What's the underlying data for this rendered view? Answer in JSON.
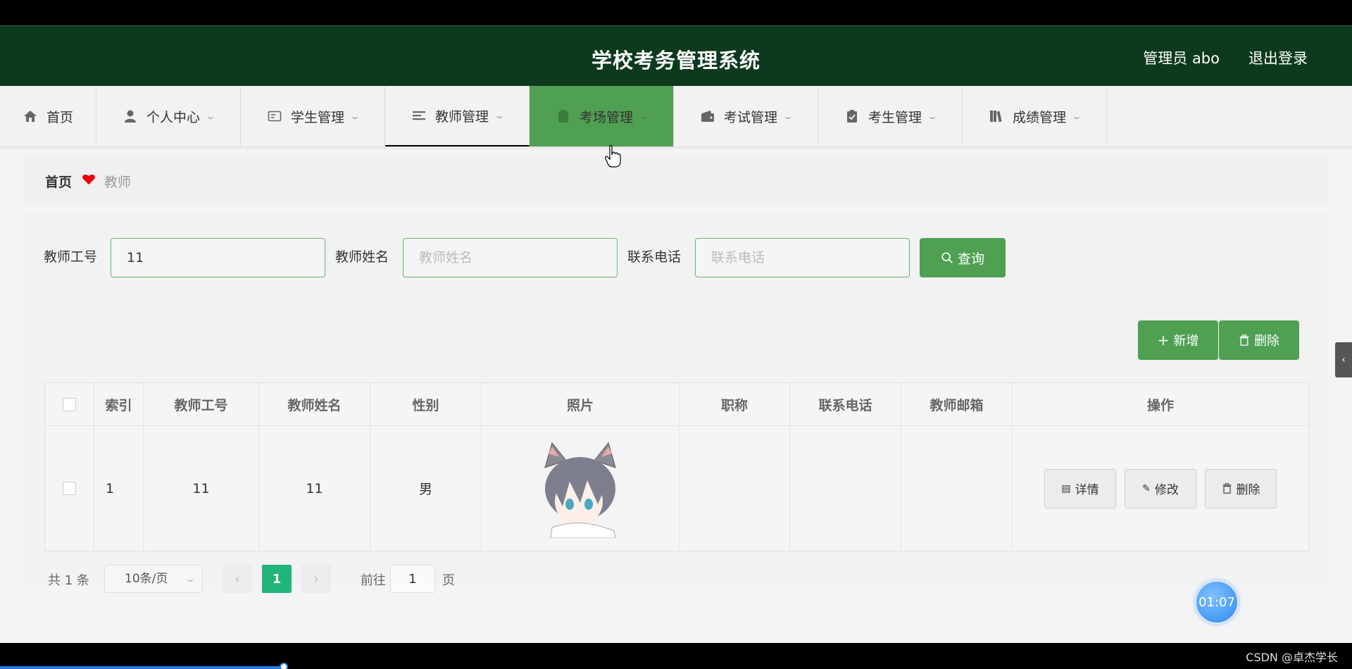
{
  "header": {
    "title": "学校考务管理系统",
    "user": "管理员 abo",
    "logout": "退出登录",
    "bg_color": "#0d3a1c"
  },
  "nav": {
    "items": [
      {
        "label": "首页",
        "icon": "home-icon"
      },
      {
        "label": "个人中心",
        "icon": "person-icon"
      },
      {
        "label": "学生管理",
        "icon": "id-card-icon"
      },
      {
        "label": "教师管理",
        "icon": "list-icon"
      },
      {
        "label": "考场管理",
        "icon": "clipboard-icon"
      },
      {
        "label": "考试管理",
        "icon": "wallet-icon"
      },
      {
        "label": "考生管理",
        "icon": "checklist-icon"
      },
      {
        "label": "成绩管理",
        "icon": "books-icon"
      }
    ],
    "active_color": "#4fa052"
  },
  "breadcrumb": {
    "home": "首页",
    "current": "教师"
  },
  "search": {
    "fields": [
      {
        "label": "教师工号",
        "value": "11",
        "placeholder": "教师工号"
      },
      {
        "label": "教师姓名",
        "value": "",
        "placeholder": "教师姓名"
      },
      {
        "label": "联系电话",
        "value": "",
        "placeholder": "联系电话"
      }
    ],
    "query_label": "查询"
  },
  "actions": {
    "add_label": "新增",
    "delete_label": "删除"
  },
  "table": {
    "columns": [
      "索引",
      "教师工号",
      "教师姓名",
      "性别",
      "照片",
      "职称",
      "联系电话",
      "教师邮箱",
      "操作"
    ],
    "rows": [
      {
        "index": "1",
        "teacher_id": "11",
        "name": "11",
        "gender": "男",
        "title": "",
        "phone": "",
        "email": ""
      }
    ],
    "row_actions": {
      "detail": "详情",
      "edit": "修改",
      "delete": "删除"
    }
  },
  "pagination": {
    "total": "共 1 条",
    "page_size": "10条/页",
    "current_page": "1",
    "goto_label": "前往",
    "goto_value": "1",
    "page_suffix": "页"
  },
  "overlay": {
    "timer": "01:07",
    "watermark": "CSDN @卓杰学长",
    "video_progress": 0.21
  }
}
